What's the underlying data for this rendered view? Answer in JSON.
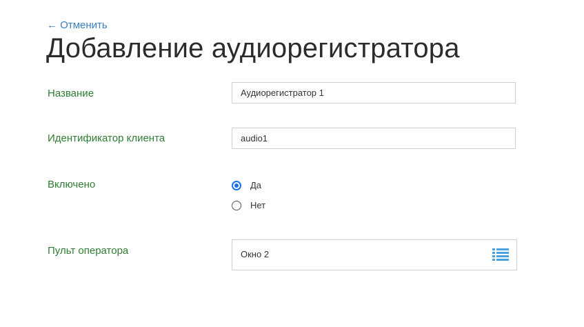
{
  "nav": {
    "back_label": "← Отменить"
  },
  "page": {
    "title": "Добавление аудиорегистратора"
  },
  "form": {
    "name": {
      "label": "Название",
      "value": "Аудиорегистратор 1"
    },
    "client_id": {
      "label": "Идентификатор клиента",
      "value": "audio1"
    },
    "enabled": {
      "label": "Включено",
      "options": [
        {
          "label": "Да",
          "checked": true
        },
        {
          "label": "Нет",
          "checked": false
        }
      ]
    },
    "operator_console": {
      "label": "Пульт оператора",
      "value": "Окно 2",
      "icon": "list-icon"
    }
  },
  "colors": {
    "label_green": "#2e7d32",
    "link_blue": "#3a7fc0",
    "radio_blue": "#1a73e8",
    "icon_blue": "#4aa3df"
  }
}
